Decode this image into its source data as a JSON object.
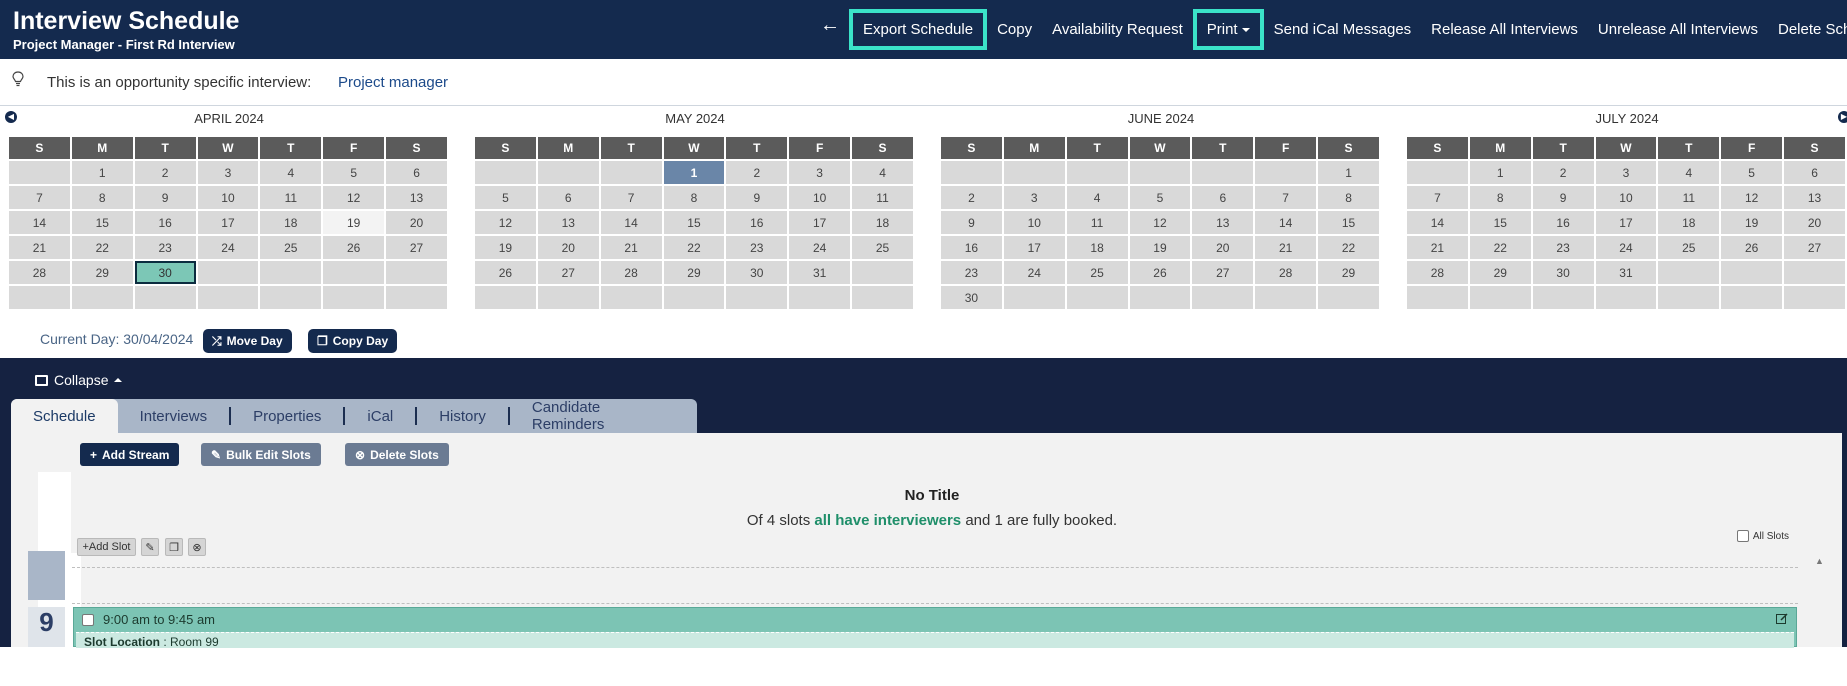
{
  "header": {
    "title": "Interview Schedule",
    "subtitle": "Project Manager - First Rd Interview",
    "back_icon": "←",
    "nav": [
      {
        "label": "Export Schedule",
        "highlighted": true
      },
      {
        "label": "Copy"
      },
      {
        "label": "Availability Request"
      },
      {
        "label": "Print",
        "highlighted": true,
        "dropdown": true
      },
      {
        "label": "Send iCal Messages"
      },
      {
        "label": "Release All Interviews"
      },
      {
        "label": "Unrelease All Interviews"
      },
      {
        "label": "Delete Schedule"
      }
    ]
  },
  "opportunity": {
    "text": "This is an opportunity specific interview:",
    "link": "Project manager"
  },
  "calendar": {
    "weekdays": [
      "S",
      "M",
      "T",
      "W",
      "T",
      "F",
      "S"
    ],
    "months": [
      {
        "title": "APRIL 2024",
        "weeks": [
          [
            "",
            "1",
            "2",
            "3",
            "4",
            "5",
            "6"
          ],
          [
            "7",
            "8",
            "9",
            "10",
            "11",
            "12",
            "13"
          ],
          [
            "14",
            "15",
            "16",
            "17",
            "18",
            "19",
            "20"
          ],
          [
            "21",
            "22",
            "23",
            "24",
            "25",
            "26",
            "27"
          ],
          [
            "28",
            "29",
            "30",
            "",
            "",
            "",
            ""
          ],
          [
            "",
            "",
            "",
            "",
            "",
            "",
            ""
          ]
        ]
      },
      {
        "title": "MAY 2024",
        "weeks": [
          [
            "",
            "",
            "",
            "1",
            "2",
            "3",
            "4"
          ],
          [
            "5",
            "6",
            "7",
            "8",
            "9",
            "10",
            "11"
          ],
          [
            "12",
            "13",
            "14",
            "15",
            "16",
            "17",
            "18"
          ],
          [
            "19",
            "20",
            "21",
            "22",
            "23",
            "24",
            "25"
          ],
          [
            "26",
            "27",
            "28",
            "29",
            "30",
            "31",
            ""
          ],
          [
            "",
            "",
            "",
            "",
            "",
            "",
            ""
          ]
        ]
      },
      {
        "title": "JUNE 2024",
        "weeks": [
          [
            "",
            "",
            "",
            "",
            "",
            "",
            "1"
          ],
          [
            "2",
            "3",
            "4",
            "5",
            "6",
            "7",
            "8"
          ],
          [
            "9",
            "10",
            "11",
            "12",
            "13",
            "14",
            "15"
          ],
          [
            "16",
            "17",
            "18",
            "19",
            "20",
            "21",
            "22"
          ],
          [
            "23",
            "24",
            "25",
            "26",
            "27",
            "28",
            "29"
          ],
          [
            "30",
            "",
            "",
            "",
            "",
            "",
            ""
          ]
        ]
      },
      {
        "title": "JULY 2024",
        "weeks": [
          [
            "",
            "1",
            "2",
            "3",
            "4",
            "5",
            "6"
          ],
          [
            "7",
            "8",
            "9",
            "10",
            "11",
            "12",
            "13"
          ],
          [
            "14",
            "15",
            "16",
            "17",
            "18",
            "19",
            "20"
          ],
          [
            "21",
            "22",
            "23",
            "24",
            "25",
            "26",
            "27"
          ],
          [
            "28",
            "29",
            "30",
            "31",
            "",
            "",
            ""
          ],
          [
            "",
            "",
            "",
            "",
            "",
            "",
            ""
          ]
        ]
      }
    ],
    "selected": {
      "month": "APRIL 2024",
      "day": "30"
    },
    "highlighted_light": {
      "month": "APRIL 2024",
      "day": "19"
    },
    "highlighted_start": {
      "month": "MAY 2024",
      "day": "1"
    }
  },
  "current_day": {
    "label": "Current Day: 30/04/2024",
    "move_button": "Move Day",
    "copy_button": "Copy Day"
  },
  "section": {
    "collapse_label": "Collapse",
    "tabs": [
      "Schedule",
      "Interviews",
      "Properties",
      "iCal",
      "History",
      "Candidate Reminders"
    ],
    "active_tab": "Schedule"
  },
  "toolbar": {
    "add_stream": "Add Stream",
    "bulk_edit": "Bulk Edit Slots",
    "delete_slots": "Delete Slots"
  },
  "stream": {
    "title": "No Title",
    "summary_prefix": "Of 4 slots ",
    "summary_bold": "all have interviewers",
    "summary_suffix": " and 1 are fully booked.",
    "add_slot": "+Add Slot",
    "all_slots_label": "All Slots"
  },
  "slot": {
    "hour": "9",
    "time_range": "9:00 am to 9:45 am",
    "location_label": "Slot Location",
    "location_value": "Room 99"
  },
  "colors": {
    "header_bg": "#142a4e",
    "highlight": "#3be3c8",
    "slot_green": "#7cc4b4",
    "tabs_bg": "#152241"
  }
}
